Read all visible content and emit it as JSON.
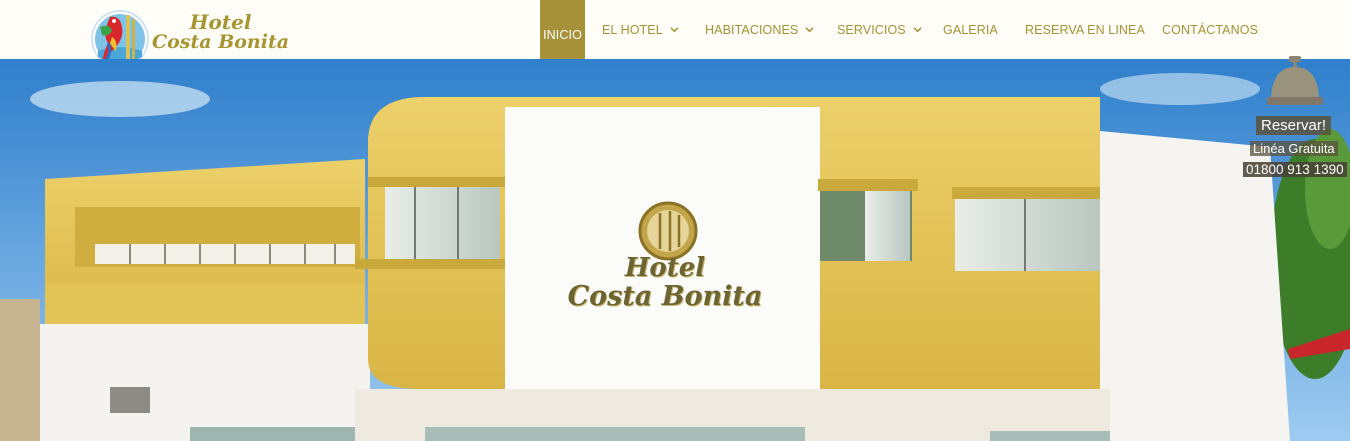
{
  "brand": {
    "line1": "Hotel",
    "line2": "Costa Bonita"
  },
  "nav": [
    {
      "label": "INICIO",
      "active": true
    },
    {
      "label": "EL HOTEL",
      "dropdown": true
    },
    {
      "label": "HABITACIONES",
      "dropdown": true
    },
    {
      "label": "SERVICIOS",
      "dropdown": true
    },
    {
      "label": "GALERIA"
    },
    {
      "label": "RESERVA EN LINEA"
    },
    {
      "label": "CONTÁCTANOS"
    }
  ],
  "sign": {
    "line1": "Hotel",
    "line2": "Costa Bonita"
  },
  "booking": {
    "title": "Reservar!",
    "subtitle": "Linéa Gratuita",
    "phone": "01800 913 1390"
  },
  "colors": {
    "accent": "#a69038",
    "nav_text": "#a39334",
    "facade_yellow": "#e6c552",
    "sky": "#3f8fd6"
  },
  "icons": [
    "parrot-logo-icon",
    "chevron-down-icon",
    "bell-icon"
  ]
}
